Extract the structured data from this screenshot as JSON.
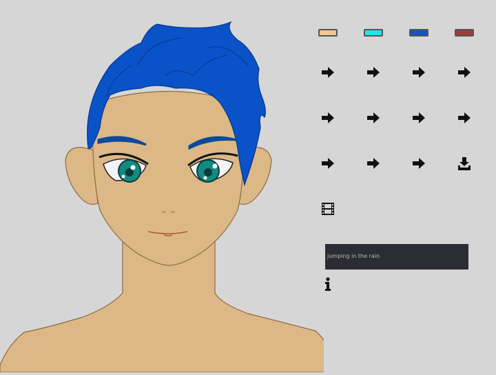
{
  "colors": {
    "skin": "#ddb887",
    "skin_outline": "#8a6a44",
    "hair": "#0a52c8",
    "hair_outline": "#07358a",
    "eye": "#128a82",
    "brow": "#0b4a9a",
    "background": "#d6d6d6"
  },
  "swatches": [
    {
      "name": "skin",
      "color": "#f7c58f"
    },
    {
      "name": "cyan",
      "color": "#1fe6ea"
    },
    {
      "name": "blue",
      "color": "#1752c4"
    },
    {
      "name": "red",
      "color": "#9c3c3a"
    }
  ],
  "buttons": {
    "rows": [
      [
        "arrow-right-icon",
        "arrow-right-icon",
        "arrow-right-icon",
        "arrow-right-icon"
      ],
      [
        "arrow-right-icon",
        "arrow-right-icon",
        "arrow-right-icon",
        "arrow-right-icon"
      ],
      [
        "arrow-right-icon",
        "arrow-right-icon",
        "arrow-right-icon",
        "download-icon"
      ]
    ],
    "film": "film-icon",
    "info": "info-icon"
  },
  "caption": {
    "text": "jumping in the rain"
  }
}
